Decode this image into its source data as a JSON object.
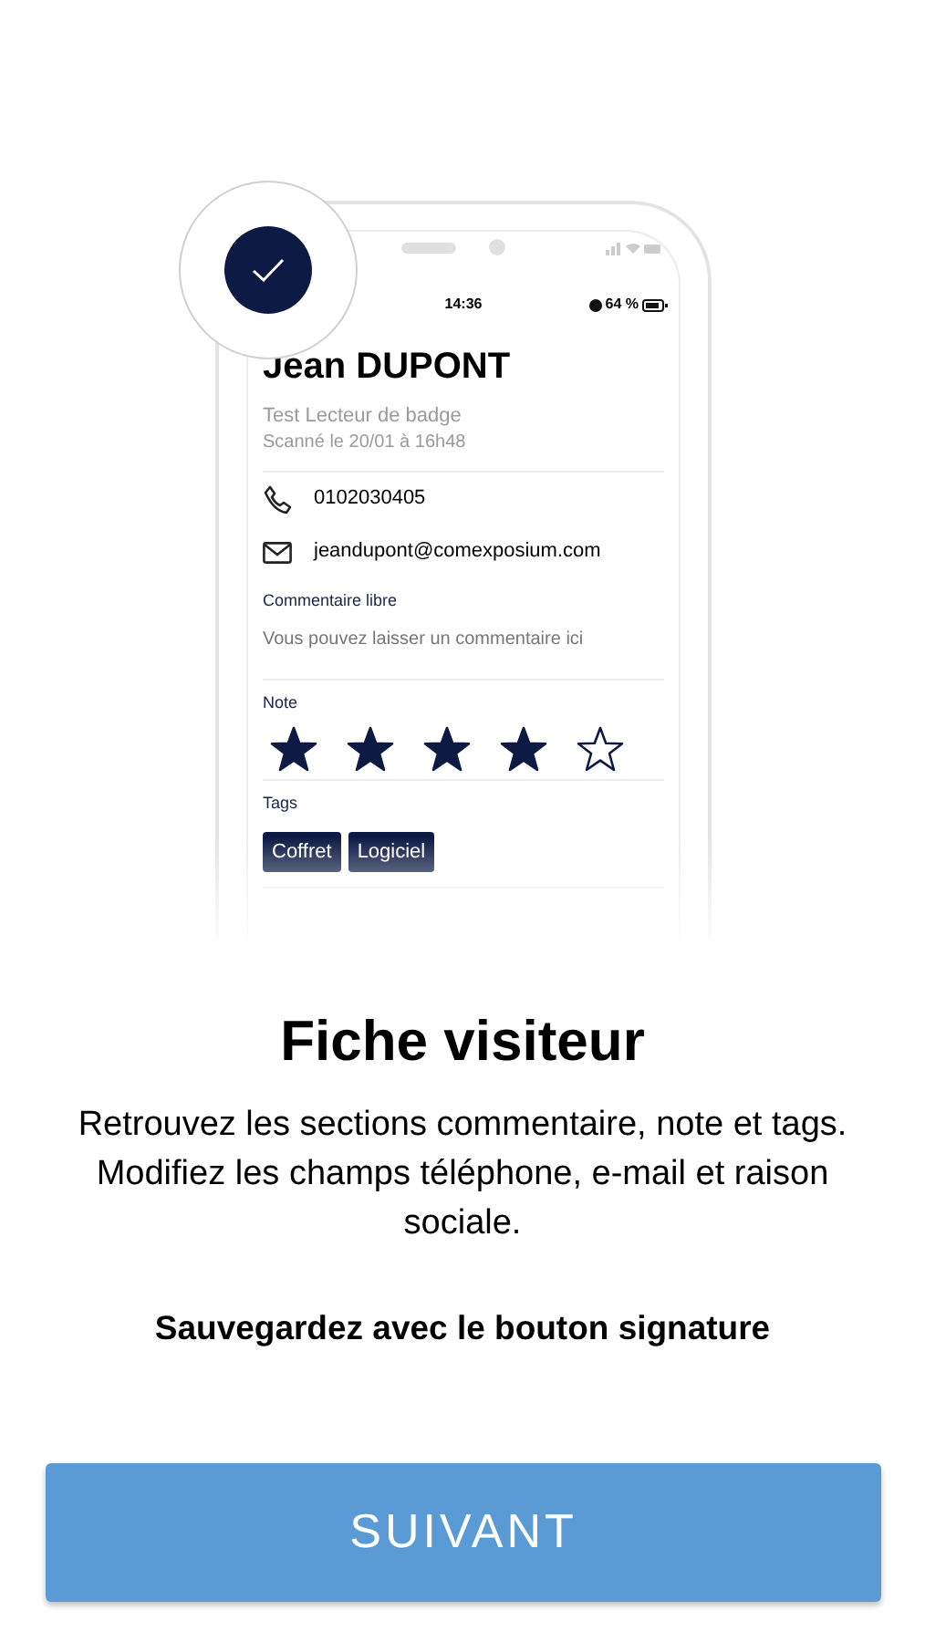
{
  "phone": {
    "time": "14:36",
    "battery": "64 %"
  },
  "contact": {
    "name": "Jean DUPONT",
    "company": "Test Lecteur de badge",
    "scanned": "Scanné le 20/01 à 16h48",
    "phone": "0102030405",
    "email": "jeandupont@comexposium.com"
  },
  "comment": {
    "label": "Commentaire libre",
    "placeholder": "Vous pouvez laisser un commentaire ici"
  },
  "rating": {
    "label": "Note",
    "stars": 4
  },
  "tags": {
    "label": "Tags",
    "items": [
      "Coffret",
      "Logiciel"
    ]
  },
  "title": "Fiche visiteur",
  "description": "Retrouvez les sections commentaire, note et tags. Modifiez les champs téléphone, e-mail et raison sociale.",
  "hint": "Sauvegardez avec le bouton signature",
  "button": "SUIVANT"
}
